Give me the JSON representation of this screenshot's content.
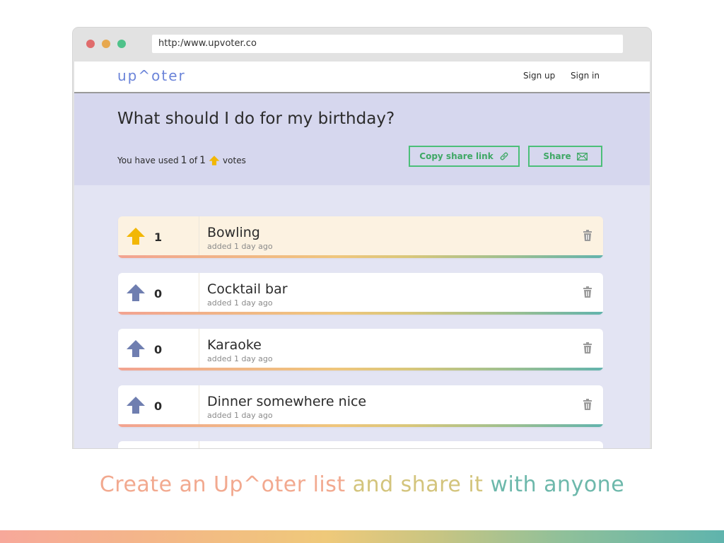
{
  "browser": {
    "url": "http:/www.upvoter.co"
  },
  "nav": {
    "logo": "up^oter",
    "signup": "Sign up",
    "signin": "Sign in"
  },
  "hero": {
    "question": "What should I do for my birthday?",
    "votes_prefix": "You have used",
    "votes_used": "1",
    "votes_of": "of",
    "votes_total": "1",
    "votes_suffix": "votes",
    "copy_link_label": "Copy share link",
    "share_label": "Share"
  },
  "items": [
    {
      "title": "Bowling",
      "count": "1",
      "meta": "added 1 day ago",
      "voted": true
    },
    {
      "title": "Cocktail bar",
      "count": "0",
      "meta": "added 1 day ago",
      "voted": false
    },
    {
      "title": "Karaoke",
      "count": "0",
      "meta": "added 1 day ago",
      "voted": false
    },
    {
      "title": "Dinner somewhere nice",
      "count": "0",
      "meta": "added 1 day ago",
      "voted": false
    }
  ],
  "tagline": {
    "parts": [
      "Create an Up^oter list",
      " and share it",
      " with anyone"
    ]
  },
  "colors": {
    "brand": "#6b84d9",
    "accent_green": "#4cbf79",
    "voted_arrow": "#f2b705",
    "unvoted_arrow": "#6f7eb0",
    "hero_bg": "#d6d7ee",
    "page_bg": "#e3e4f3"
  },
  "icons": {
    "upvote": "arrow-up-icon",
    "trash": "trash-icon",
    "link": "link-icon",
    "mail": "mail-icon"
  }
}
